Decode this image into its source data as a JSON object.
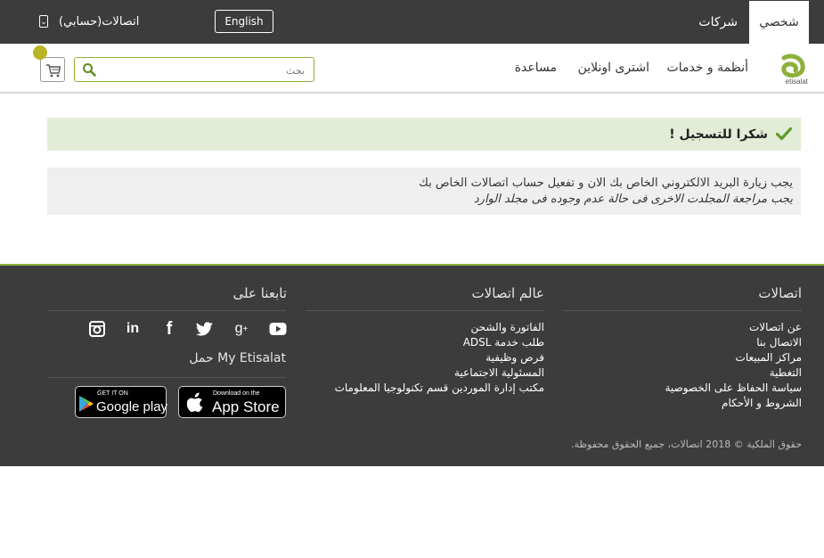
{
  "topbar": {
    "tab_personal": "شخصي",
    "tab_business": "شركات",
    "language_button": "English",
    "account_link": "اتصالات(حسابي)"
  },
  "nav": {
    "logo_text": "etisalat",
    "items": [
      "أنظمة و خدمات",
      "اشترى اونلاين",
      "مساعدة"
    ],
    "search_placeholder": "بحث"
  },
  "alert": {
    "title": "شكرا للتسجيل !"
  },
  "info": {
    "line1": "يجب زيارة البريد الالكتروني الخاص بك الان و تفعيل حساب اتصالات الخاص بك",
    "line2": "يجب مراجعة المجلدت الاخرى فى حالة عدم وجوده فى مجلد الوارد"
  },
  "footer": {
    "col1": {
      "title": "اتصالات",
      "links": [
        "عن اتصالات",
        "الاتصال بنا",
        "مراكز المبيعات",
        "التغطية",
        "سياسة الحفاظ على الخصوصية",
        "الشروط و الأحكام"
      ]
    },
    "col2": {
      "title": "عالم اتصالات",
      "links": [
        "الفاتورة والشحن",
        "طلب خدمة ADSL",
        "فرص وظيفية",
        "المسئولية الاجتماعية",
        "مكتب إدارة الموردين قسم تكنولوجيا المعلومات"
      ]
    },
    "col3": {
      "title": "تابعنا على",
      "social": [
        "youtube-icon",
        "google-plus-icon",
        "twitter-icon",
        "facebook-icon",
        "linkedin-icon",
        "instagram-icon"
      ],
      "download_title": "حمل My Etisalat",
      "app_store": {
        "small": "Download on the",
        "big": "App Store"
      },
      "google_play": {
        "small": "GET IT ON",
        "big": "Google play"
      }
    },
    "copyright": "حقوق الملكية © 2018 اتصالات، جميع الحقوق محفوظة."
  },
  "colors": {
    "brand_green": "#8db03b",
    "dark_bar": "#3c3c3c",
    "alert_bg": "#e3ecd6",
    "badge": "#b8b528"
  }
}
